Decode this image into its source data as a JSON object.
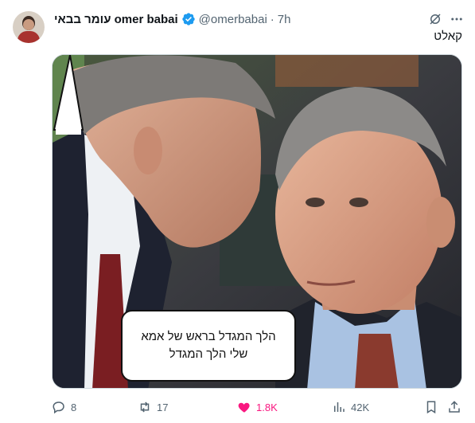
{
  "author": {
    "display_name": "עומר בבאי omer babai",
    "handle": "@omerbabai",
    "separator": "·",
    "time": "7h",
    "avatar_icon": "user-avatar"
  },
  "tweet": {
    "text": "קאלט"
  },
  "media": {
    "caption_line1": "הלך המגדל בראש של אמא",
    "caption_line2": "שלי הלך המגדל"
  },
  "actions": {
    "replies": "8",
    "retweets": "17",
    "likes": "1.8K",
    "views": "42K"
  },
  "colors": {
    "accent": "#1d9bf0",
    "like": "#f91880",
    "muted": "#536471"
  },
  "icons": [
    "verified-badge-icon",
    "grok-icon",
    "more-icon",
    "reply-icon",
    "retweet-icon",
    "like-icon",
    "views-icon",
    "bookmark-icon",
    "share-icon"
  ]
}
